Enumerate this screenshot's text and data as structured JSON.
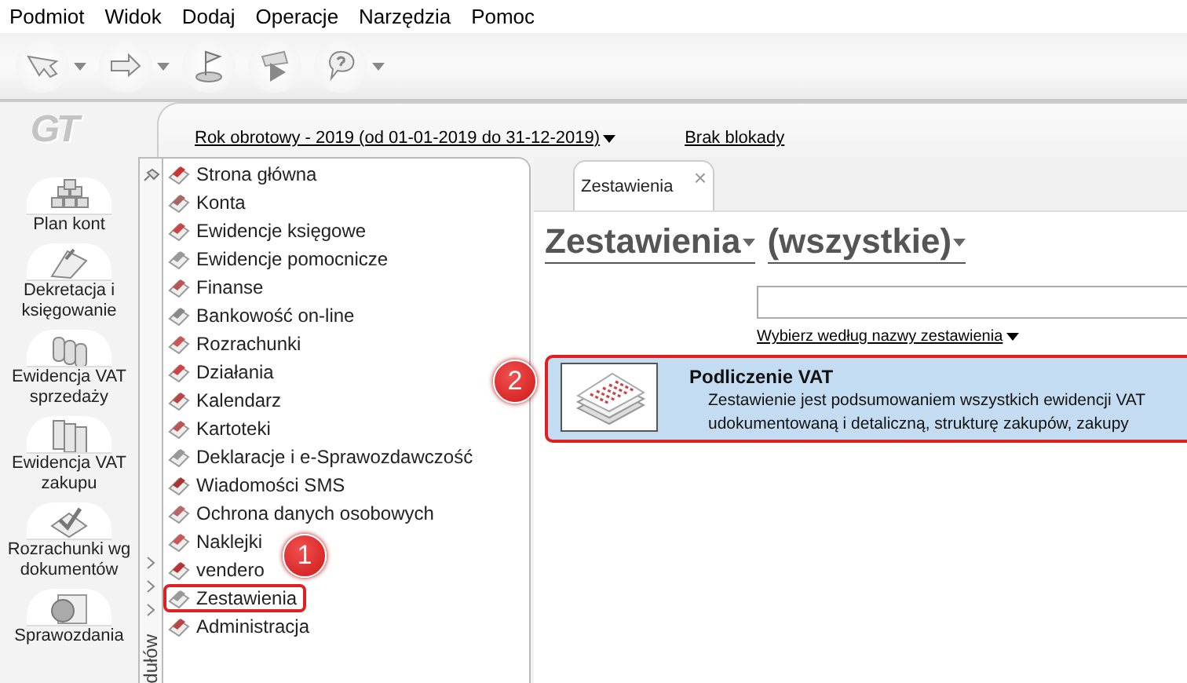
{
  "menu": [
    "Podmiot",
    "Widok",
    "Dodaj",
    "Operacje",
    "Narzędzia",
    "Pomoc"
  ],
  "toolbar": [
    {
      "kind": "arrow-left",
      "dropdown": true
    },
    {
      "kind": "arrow-right",
      "dropdown": true
    },
    {
      "kind": "flag",
      "dropdown": false
    },
    {
      "kind": "play",
      "dropdown": false
    },
    {
      "kind": "help",
      "dropdown": true
    }
  ],
  "logo": "GT",
  "sidebar": [
    {
      "label": "Plan kont",
      "kind": "blocks"
    },
    {
      "label": "Dekretacja i księgowanie",
      "kind": "clip"
    },
    {
      "label": "Ewidencja VAT sprzedaży",
      "kind": "coins"
    },
    {
      "label": "Ewidencja VAT zakupu",
      "kind": "books"
    },
    {
      "label": "Rozrachunki wg dokumentów",
      "kind": "check"
    },
    {
      "label": "Sprawozdania",
      "kind": "pie"
    }
  ],
  "header": {
    "fiscal_year": "Rok obrotowy - 2019  (od 01-01-2019 do 31-12-2019)",
    "lock": "Brak blokady"
  },
  "modules_strip": {
    "label": "dułów"
  },
  "modules": [
    {
      "label": "Strona główna",
      "annotated": false
    },
    {
      "label": "Konta",
      "annotated": false
    },
    {
      "label": "Ewidencje księgowe",
      "annotated": false
    },
    {
      "label": "Ewidencje pomocnicze",
      "annotated": false
    },
    {
      "label": "Finanse",
      "annotated": false
    },
    {
      "label": "Bankowość on-line",
      "annotated": false
    },
    {
      "label": "Rozrachunki",
      "annotated": false
    },
    {
      "label": "Działania",
      "annotated": false
    },
    {
      "label": "Kalendarz",
      "annotated": false
    },
    {
      "label": "Kartoteki",
      "annotated": false
    },
    {
      "label": "Deklaracje i e-Sprawozdawczość",
      "annotated": false
    },
    {
      "label": "Wiadomości SMS",
      "annotated": false
    },
    {
      "label": "Ochrona danych osobowych",
      "annotated": false
    },
    {
      "label": "Naklejki",
      "annotated": false
    },
    {
      "label": "vendero",
      "annotated": false
    },
    {
      "label": "Zestawienia",
      "annotated": true
    },
    {
      "label": "Administracja",
      "annotated": false
    }
  ],
  "tabs": [
    {
      "label": "Zestawienia",
      "selected": true,
      "close": "×"
    }
  ],
  "heading": {
    "category": "Zestawienia",
    "filter": "(wszystkie)"
  },
  "sort_link": "Wybierz według nazwy zestawienia",
  "reports": [
    {
      "title": "Podliczenie VAT",
      "description": [
        "Zestawienie jest podsumowaniem wszystkich ewidencji VAT",
        "udokumentowaną i detaliczną, strukturę zakupów, zakupy"
      ],
      "selected": true,
      "annotated": true
    }
  ],
  "badges": [
    "1",
    "2"
  ]
}
